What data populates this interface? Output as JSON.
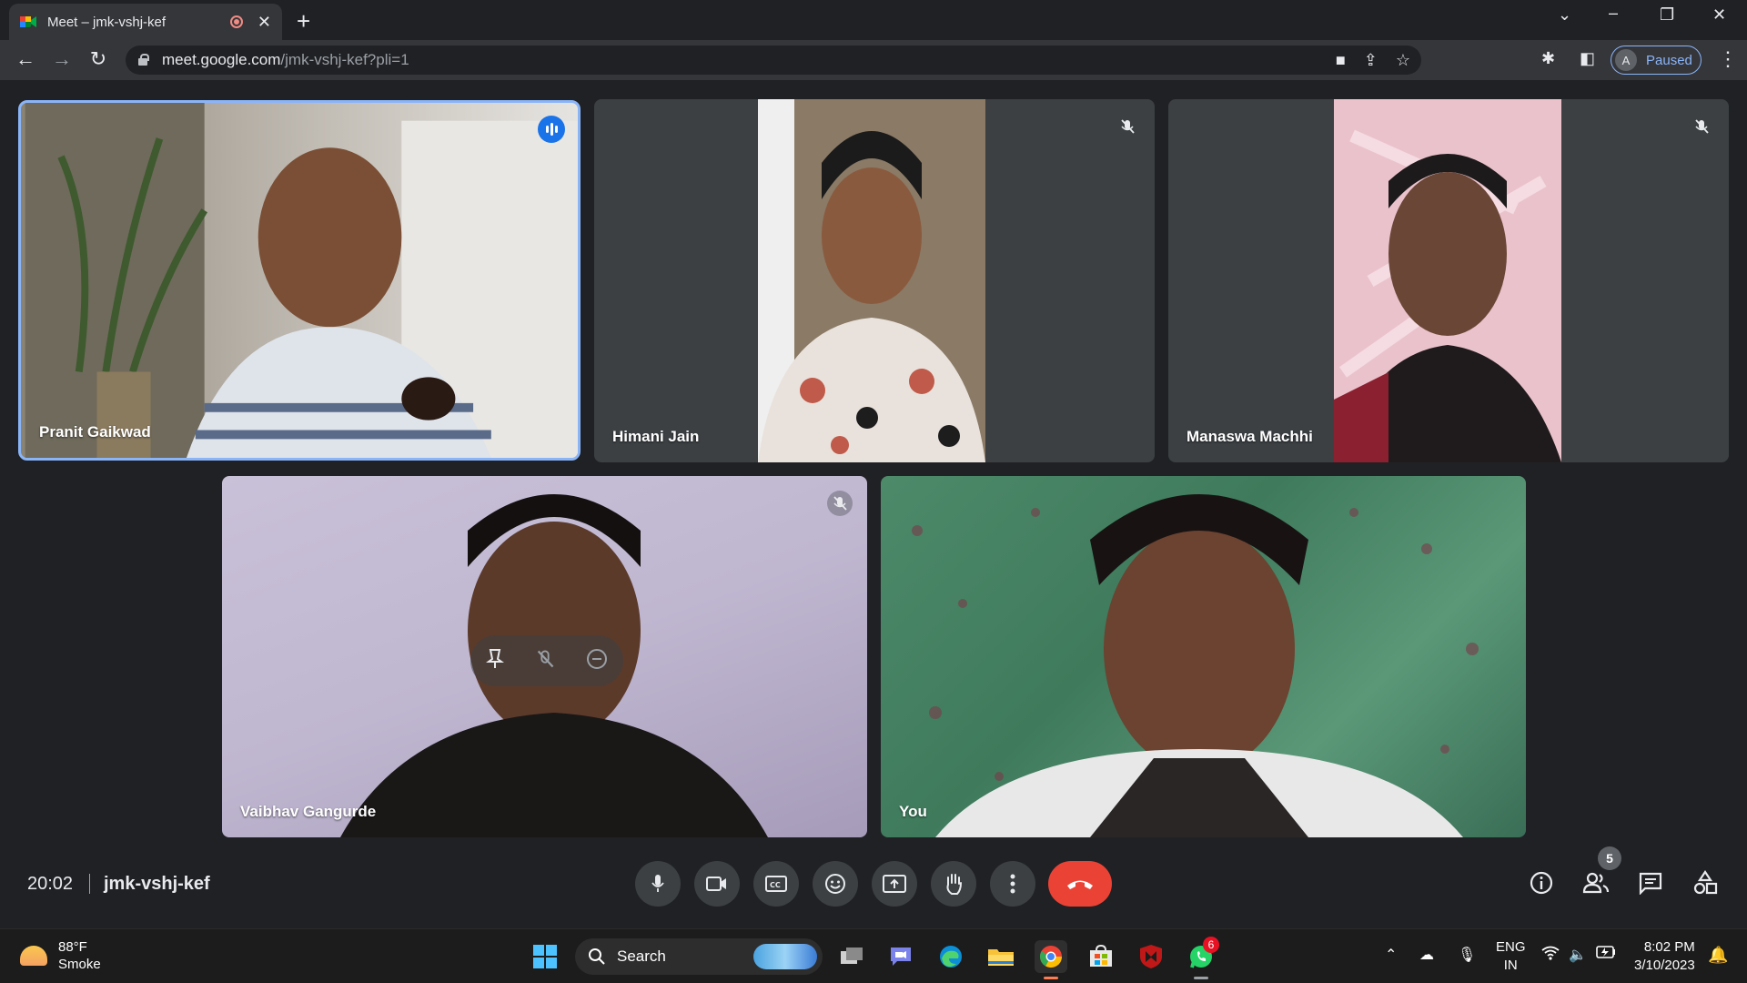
{
  "browser": {
    "tab_title": "Meet – jmk-vshj-kef",
    "tab_close": "✕",
    "new_tab": "+",
    "url_host": "meet.google.com",
    "url_path": "/jmk-vshj-kef?pli=1",
    "profile_initial": "A",
    "profile_status": "Paused"
  },
  "participants": [
    {
      "name": "Pranit Gaikwad",
      "state": "speaking"
    },
    {
      "name": "Himani Jain",
      "state": "muted"
    },
    {
      "name": "Manaswa Machhi",
      "state": "muted"
    },
    {
      "name": "Vaibhav Gangurde",
      "state": "muted"
    },
    {
      "name": "You",
      "state": "self"
    }
  ],
  "meeting": {
    "time": "20:02",
    "code": "jmk-vshj-kef",
    "people_count": "5"
  },
  "taskbar": {
    "weather_temp": "88°F",
    "weather_desc": "Smoke",
    "search_label": "Search",
    "whatsapp_badge": "6",
    "lang_line1": "ENG",
    "lang_line2": "IN",
    "time": "8:02 PM",
    "date": "3/10/2023"
  },
  "colors": {
    "speaking_blue": "#1a73e8",
    "end_call_red": "#ea4335",
    "tile_bg": "#3c4043"
  }
}
